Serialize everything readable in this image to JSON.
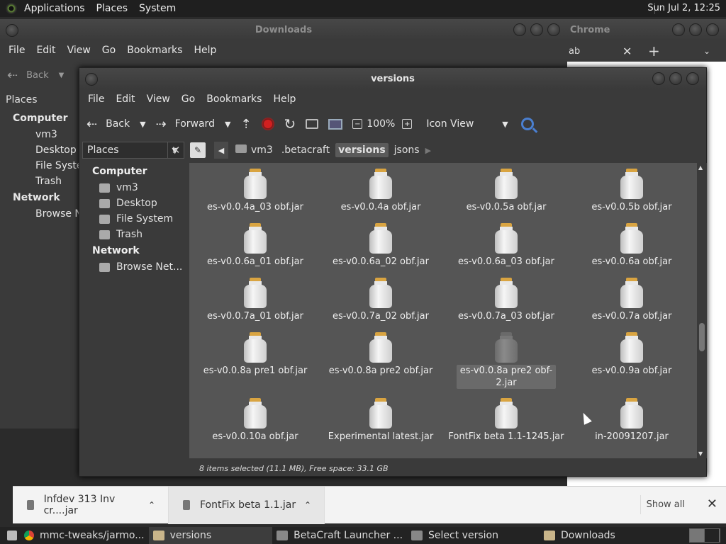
{
  "top_panel": {
    "menus": [
      "Applications",
      "Places",
      "System"
    ],
    "clock": "Sun Jul  2, 12:25"
  },
  "downloads_window": {
    "title": "Downloads",
    "menus": [
      "File",
      "Edit",
      "View",
      "Go",
      "Bookmarks",
      "Help"
    ],
    "back_label": "Back",
    "places_label": "Places",
    "sidebar": {
      "computer_header": "Computer",
      "items": [
        "vm3",
        "Desktop",
        "File Syster",
        "Trash"
      ],
      "network_header": "Network",
      "network_items": [
        "Browse Ne"
      ]
    }
  },
  "chrome_window": {
    "title": "Chrome",
    "tab_fragment": "ab"
  },
  "versions_window": {
    "title": "versions",
    "menus": [
      "File",
      "Edit",
      "View",
      "Go",
      "Bookmarks",
      "Help"
    ],
    "toolbar": {
      "back": "Back",
      "forward": "Forward",
      "zoom": "100%",
      "view_mode": "Icon View"
    },
    "places_label": "Places",
    "breadcrumbs": [
      "vm3",
      ".betacraft",
      "versions",
      "jsons"
    ],
    "sidebar": {
      "computer_header": "Computer",
      "items": [
        "vm3",
        "Desktop",
        "File System",
        "Trash"
      ],
      "network_header": "Network",
      "network_items": [
        "Browse Net..."
      ]
    },
    "files": [
      {
        "name": "es-v0.0.4a_03 obf.jar"
      },
      {
        "name": "es-v0.0.4a obf.jar"
      },
      {
        "name": "es-v0.0.5a obf.jar"
      },
      {
        "name": "es-v0.0.5b obf.jar"
      },
      {
        "name": "es-v0.0.6a_01 obf.jar"
      },
      {
        "name": "es-v0.0.6a_02 obf.jar"
      },
      {
        "name": "es-v0.0.6a_03 obf.jar"
      },
      {
        "name": "es-v0.0.6a obf.jar"
      },
      {
        "name": "es-v0.0.7a_01 obf.jar"
      },
      {
        "name": "es-v0.0.7a_02 obf.jar"
      },
      {
        "name": "es-v0.0.7a_03 obf.jar"
      },
      {
        "name": "es-v0.0.7a obf.jar"
      },
      {
        "name": "es-v0.0.8a pre1 obf.jar"
      },
      {
        "name": "es-v0.0.8a pre2 obf.jar"
      },
      {
        "name": "es-v0.0.8a pre2 obf-2.jar"
      },
      {
        "name": "es-v0.0.9a obf.jar"
      },
      {
        "name": "es-v0.0.10a obf.jar"
      },
      {
        "name": "Experimental latest.jar"
      },
      {
        "name": "FontFix beta 1.1-1245.jar"
      },
      {
        "name": "in-20091207.jar"
      }
    ],
    "status": "8 items selected (11.1 MB), Free space: 33.1 GB"
  },
  "download_shelf": {
    "items": [
      {
        "name": "Infdev 313 Inv cr....jar"
      },
      {
        "name": "FontFix beta 1.1.jar"
      }
    ],
    "show_all": "Show all"
  },
  "taskbar": {
    "tasks": [
      "mmc-tweaks/jarmo...",
      "versions",
      "BetaCraft Launcher ...",
      "Select version",
      "Downloads"
    ]
  }
}
